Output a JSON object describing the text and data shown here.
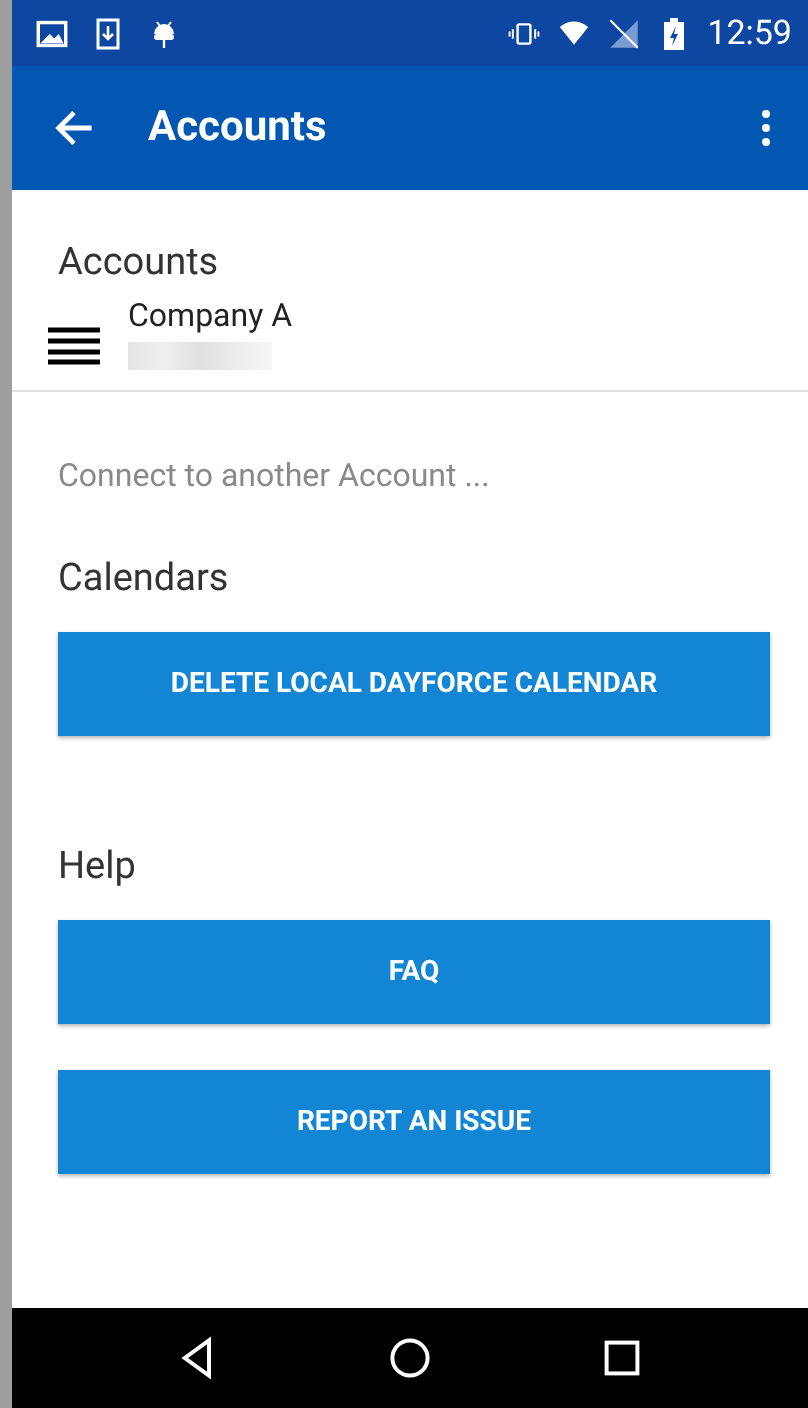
{
  "status_bar": {
    "time": "12:59"
  },
  "app_bar": {
    "title": "Accounts"
  },
  "accounts": {
    "heading": "Accounts",
    "items": [
      {
        "name": "Company A"
      }
    ],
    "connect": "Connect to another Account ..."
  },
  "calendars": {
    "heading": "Calendars",
    "buttons": [
      "DELETE LOCAL DAYFORCE CALENDAR"
    ]
  },
  "help": {
    "heading": "Help",
    "buttons": [
      "FAQ",
      "REPORT AN ISSUE"
    ]
  }
}
